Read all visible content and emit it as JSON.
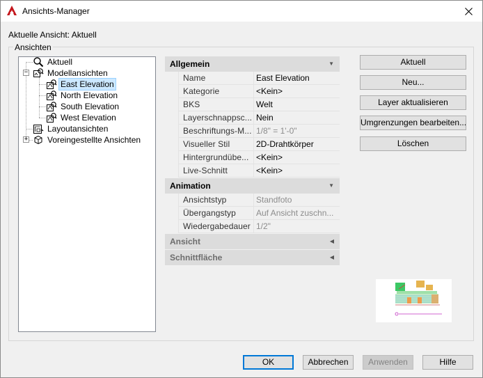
{
  "window": {
    "title": "Ansichts-Manager"
  },
  "current_view_label": "Aktuelle Ansicht: Aktuell",
  "group_title": "Ansichten",
  "tree": {
    "aktuell": "Aktuell",
    "modellansichten": "Modellansichten",
    "views": [
      "East Elevation",
      "North Elevation",
      "South Elevation",
      "West Elevation"
    ],
    "layoutansichten": "Layoutansichten",
    "voreingestellte": "Voreingestellte Ansichten"
  },
  "properties": {
    "allgemein": {
      "title": "Allgemein",
      "rows": [
        {
          "name": "Name",
          "value": "East Elevation",
          "dim": false
        },
        {
          "name": "Kategorie",
          "value": "<Kein>",
          "dim": false
        },
        {
          "name": "BKS",
          "value": "Welt",
          "dim": false
        },
        {
          "name": "Layerschnappsc...",
          "value": "Nein",
          "dim": false
        },
        {
          "name": "Beschriftungs-M...",
          "value": "1/8\" = 1'-0\"",
          "dim": true
        },
        {
          "name": "Visueller Stil",
          "value": "2D-Drahtkörper",
          "dim": false
        },
        {
          "name": "Hintergrundübe...",
          "value": "<Kein>",
          "dim": false
        },
        {
          "name": "Live-Schnitt",
          "value": "<Kein>",
          "dim": false
        }
      ]
    },
    "animation": {
      "title": "Animation",
      "rows": [
        {
          "name": "Ansichtstyp",
          "value": "Standfoto",
          "dim": true
        },
        {
          "name": "Übergangstyp",
          "value": "Auf Ansicht zuschn...",
          "dim": true
        },
        {
          "name": "Wiedergabedauer",
          "value": "1/2\"",
          "dim": true
        }
      ]
    },
    "ansicht": {
      "title": "Ansicht"
    },
    "schnittflaeche": {
      "title": "Schnittfläche"
    }
  },
  "buttons": {
    "aktuell": "Aktuell",
    "neu": "Neu...",
    "layer": "Layer aktualisieren",
    "umgrenzungen": "Umgrenzungen bearbeiten...",
    "loeschen": "Löschen",
    "ok": "OK",
    "abbrechen": "Abbrechen",
    "anwenden": "Anwenden",
    "hilfe": "Hilfe"
  },
  "colors": {
    "accent": "#0078d7",
    "app_red": "#c4161c",
    "selection": "#cce8ff"
  }
}
